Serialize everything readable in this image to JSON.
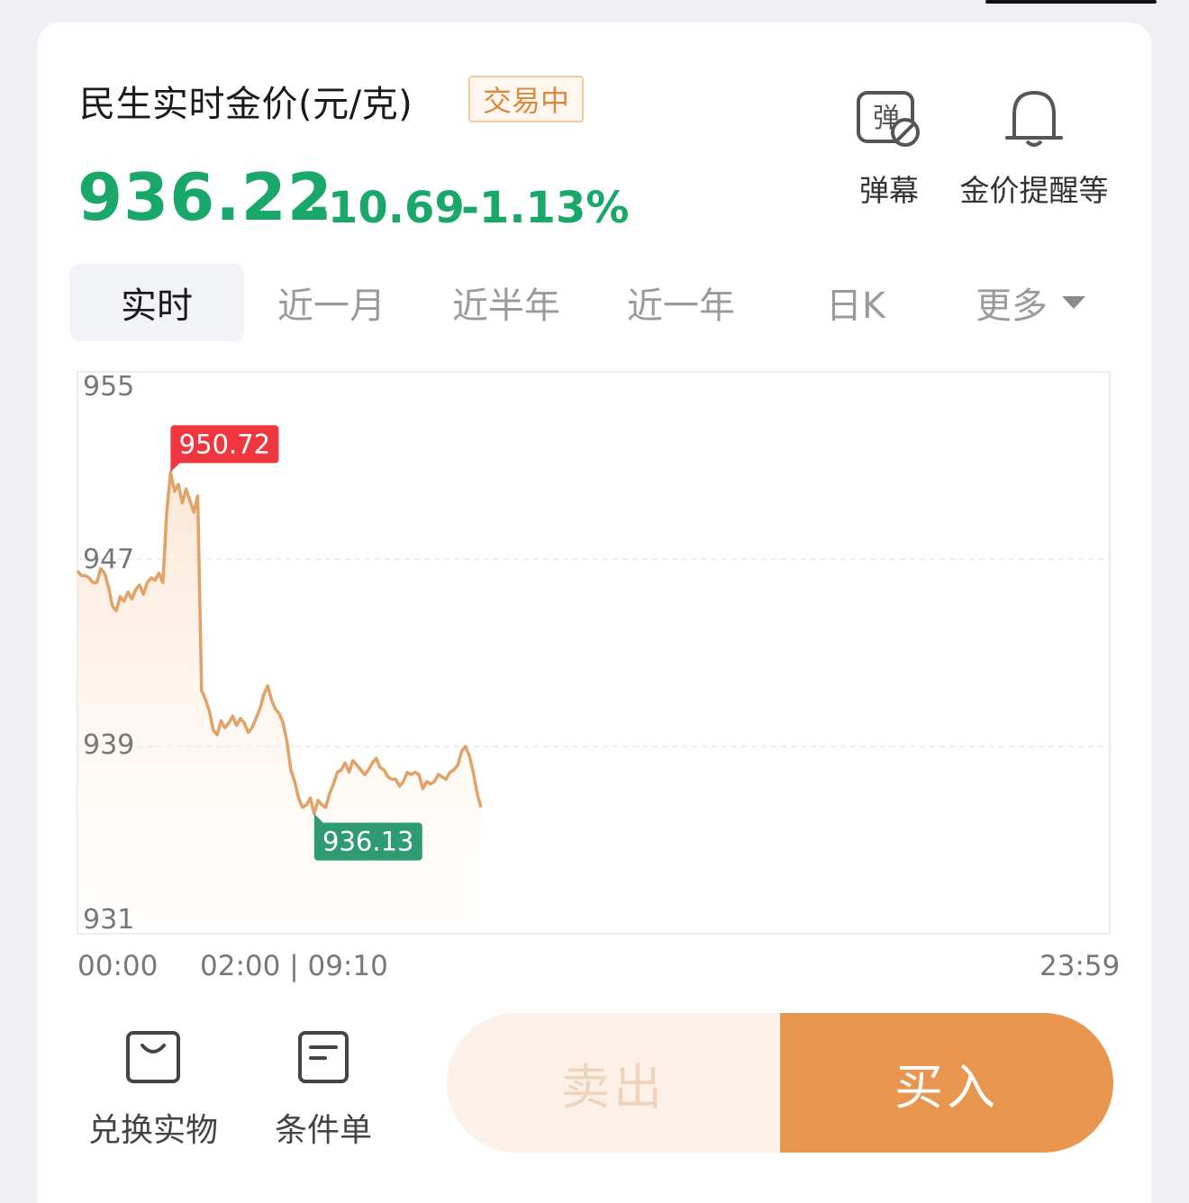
{
  "header": {
    "title": "民生实时金价(元/克)",
    "status": "交易中",
    "price": "936.22",
    "change": "-10.69",
    "change_pct": "-1.13%",
    "tools": [
      {
        "icon": "danmaku-icon",
        "label": "弹幕",
        "icon_text": "弹"
      },
      {
        "icon": "bell-icon",
        "label": "金价提醒等"
      }
    ]
  },
  "tabs": [
    {
      "label": "实时",
      "active": true
    },
    {
      "label": "近一月"
    },
    {
      "label": "近半年"
    },
    {
      "label": "近一年"
    },
    {
      "label": "日K"
    },
    {
      "label": "更多"
    }
  ],
  "chart_data": {
    "type": "line",
    "y_ticks": [
      "955",
      "947",
      "939",
      "931"
    ],
    "ylim": [
      931,
      955
    ],
    "x_labels": {
      "start": "00:00",
      "mid": "02:00 | 09:10",
      "end": "23:59"
    },
    "high_label": "950.72",
    "low_label": "936.13",
    "high": 950.72,
    "low": 936.13,
    "line_color": "#e0a266",
    "high_color": "#f0363f",
    "low_color": "#2f9b74",
    "grid": "dashed horizontal",
    "values": [
      946.5,
      946.3,
      946.3,
      946.2,
      946.0,
      946.0,
      946.6,
      946.4,
      945.8,
      945.0,
      944.8,
      945.4,
      945.2,
      945.6,
      945.3,
      945.7,
      945.9,
      945.5,
      946.0,
      946.2,
      946.1,
      946.4,
      946.0,
      949.0,
      950.72,
      949.9,
      950.2,
      949.4,
      950.0,
      949.5,
      949.0,
      949.7,
      941.4,
      941.0,
      940.5,
      939.7,
      939.5,
      940.1,
      939.8,
      940.0,
      940.3,
      939.9,
      940.2,
      940.0,
      939.6,
      939.8,
      940.2,
      940.6,
      941.2,
      941.6,
      941.0,
      940.6,
      940.4,
      940.0,
      939.2,
      938.0,
      937.5,
      936.8,
      936.4,
      936.5,
      936.8,
      936.13,
      936.7,
      936.5,
      936.4,
      937.0,
      937.4,
      937.9,
      938.0,
      938.3,
      937.9,
      938.4,
      938.2,
      938.0,
      937.8,
      938.0,
      938.3,
      938.5,
      938.1,
      938.0,
      937.7,
      937.6,
      937.6,
      937.3,
      937.5,
      937.9,
      937.8,
      937.9,
      937.8,
      937.2,
      937.5,
      937.4,
      937.5,
      937.8,
      937.7,
      937.6,
      937.9,
      938.0,
      938.2,
      938.8,
      939.0,
      938.6,
      937.9,
      937.0,
      936.4
    ]
  },
  "bottom": {
    "redeem_label": "兑换实物",
    "condition_label": "条件单",
    "sell_label": "卖出",
    "buy_label": "买入"
  }
}
